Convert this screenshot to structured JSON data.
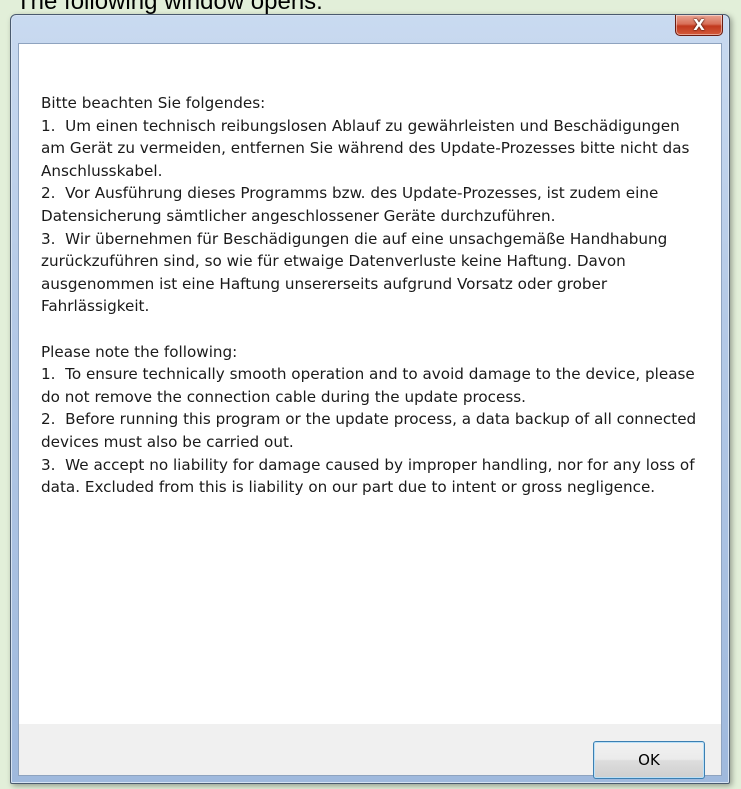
{
  "caption": "The following window opens:",
  "dialog": {
    "close_glyph": "X",
    "message": "Bitte beachten Sie folgendes:\n1.  Um einen technisch reibungslosen Ablauf zu gewährleisten und Beschädigungen am Gerät zu vermeiden, entfernen Sie während des Update-Prozesses bitte nicht das Anschlusskabel.\n2.  Vor Ausführung dieses Programms bzw. des Update-Prozesses, ist zudem eine Datensicherung sämtlicher angeschlossener Geräte durchzuführen.\n3.  Wir übernehmen für Beschädigungen die auf eine unsachgemäße Handhabung zurückzuführen sind, so wie für etwaige Datenverluste keine Haftung. Davon ausgenommen ist eine Haftung unsererseits aufgrund Vorsatz oder grober Fahrlässigkeit.\n\nPlease note the following:\n1.  To ensure technically smooth operation and to avoid damage to the device, please do not remove the connection cable during the update process.\n2.  Before running this program or the update process, a data backup of all connected devices must also be carried out.\n3.  We accept no liability for damage caused by improper handling, nor for any loss of data. Excluded from this is liability on our part due to intent or gross negligence.",
    "ok_label": "OK"
  },
  "colors": {
    "page_background": "#e2efd9",
    "close_button": "#c1391f",
    "default_button_border": "#3c7fb1"
  }
}
